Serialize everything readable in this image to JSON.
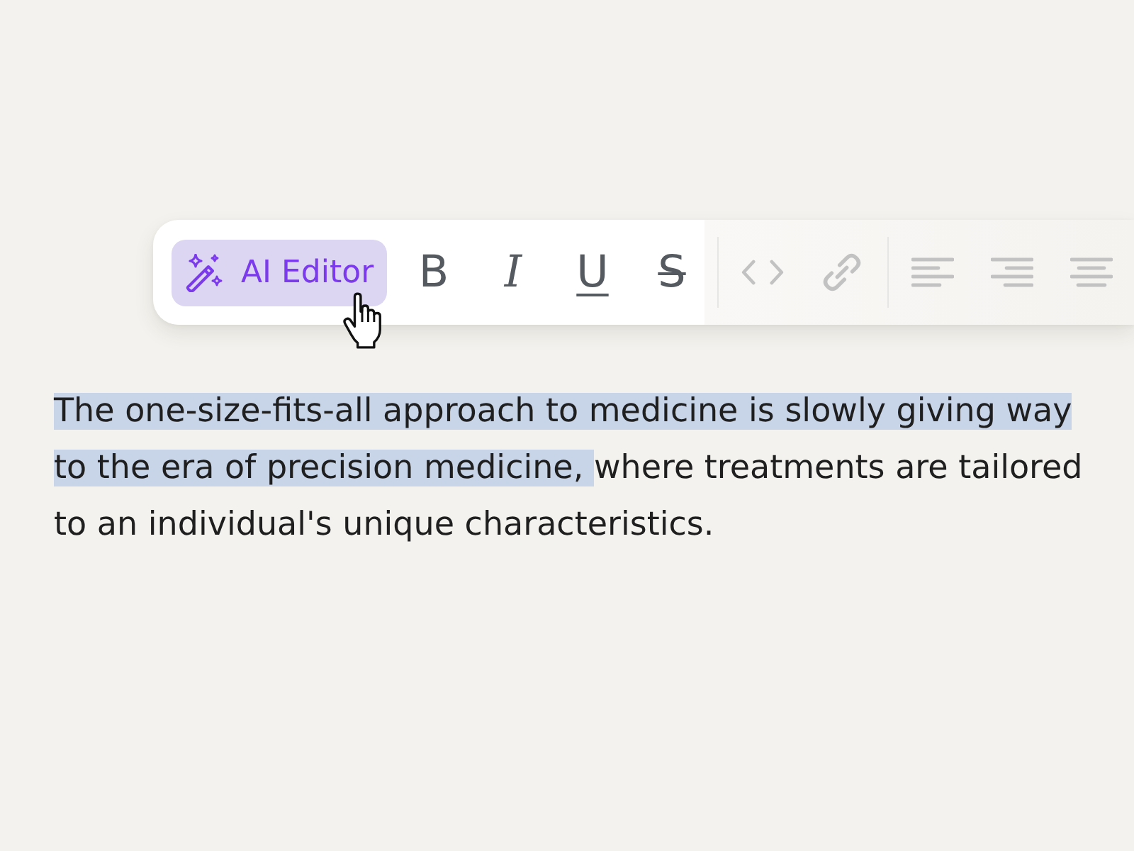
{
  "toolbar": {
    "ai_editor": {
      "label": "AI Editor",
      "hovered": true
    },
    "groups": [
      {
        "tools": [
          {
            "kind": "bold",
            "label": "B",
            "dimmed": false
          },
          {
            "kind": "italic",
            "label": "I",
            "dimmed": false
          },
          {
            "kind": "underline",
            "label": "U",
            "dimmed": false
          },
          {
            "kind": "strikethrough",
            "label": "S",
            "dimmed": false
          }
        ]
      },
      {
        "tools": [
          {
            "kind": "code",
            "dimmed": true
          },
          {
            "kind": "link",
            "dimmed": true
          }
        ]
      },
      {
        "tools": [
          {
            "kind": "align_left",
            "dimmed": true
          },
          {
            "kind": "align_right",
            "dimmed": true
          },
          {
            "kind": "align_center",
            "dimmed": true
          }
        ]
      }
    ]
  },
  "paragraph": {
    "segments": [
      {
        "text": "The one-size-fits-all approach to medicine is slowly giving way to the era of precision medicine, ",
        "selected": true
      },
      {
        "text": "where treatments are tailored to an individual's unique characteristics.",
        "selected": false
      }
    ]
  }
}
